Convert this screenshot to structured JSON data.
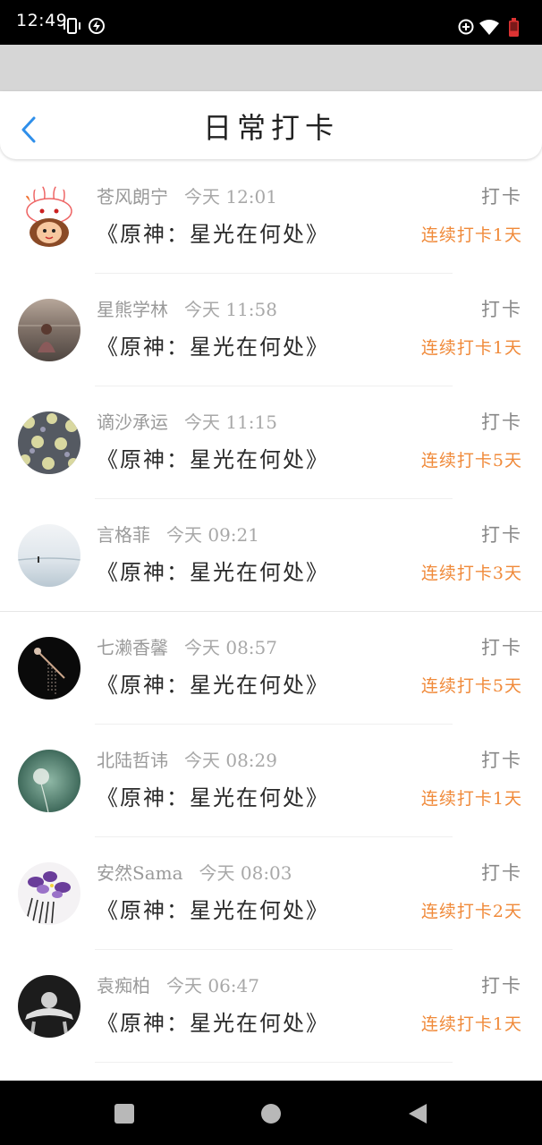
{
  "status_bar": {
    "time": "12:49",
    "left_icons": [
      "vibrate-icon",
      "charging-icon"
    ],
    "right_icons": [
      "data-saver-icon",
      "wifi-icon",
      "battery-low-icon"
    ]
  },
  "header": {
    "title": "日常打卡",
    "back_icon": "chevron-left-icon",
    "accent_color": "#2f8fea"
  },
  "records": [
    {
      "name": "苍风朗宁",
      "time": "今天 12:01",
      "book": "《原神：星光在何处》",
      "action": "打卡",
      "streak": "连续打卡1天",
      "avatar": "cartoon-bunny-girl"
    },
    {
      "name": "星熊学林",
      "time": "今天 11:58",
      "book": "《原神：星光在何处》",
      "action": "打卡",
      "streak": "连续打卡1天",
      "avatar": "sea-sunset-girl"
    },
    {
      "name": "谪沙承运",
      "time": "今天 11:15",
      "book": "《原神：星光在何处》",
      "action": "打卡",
      "streak": "连续打卡5天",
      "avatar": "floral-pattern"
    },
    {
      "name": "言格菲",
      "time": "今天 09:21",
      "book": "《原神：星光在何处》",
      "action": "打卡",
      "streak": "连续打卡3天",
      "avatar": "beach-figure"
    },
    {
      "name": "七濑香馨",
      "time": "今天 08:57",
      "book": "《原神：星光在何处》",
      "action": "打卡",
      "streak": "连续打卡5天",
      "avatar": "hairpin-dark"
    },
    {
      "name": "北陆哲讳",
      "time": "今天 08:29",
      "book": "《原神：星光在何处》",
      "action": "打卡",
      "streak": "连续打卡1天",
      "avatar": "dandelion"
    },
    {
      "name": "安然Sama",
      "time": "今天 08:03",
      "book": "《原神：星光在何处》",
      "action": "打卡",
      "streak": "连续打卡2天",
      "avatar": "purple-flowers-comb"
    },
    {
      "name": "袁痴柏",
      "time": "今天 06:47",
      "book": "《原神：星光在何处》",
      "action": "打卡",
      "streak": "连续打卡1天",
      "avatar": "bw-portrait"
    }
  ],
  "colors": {
    "streak": "#f08a3a",
    "name": "#9a9a9a",
    "checkin": "#888888"
  },
  "nav_bar": {
    "icons": [
      "recents-square-icon",
      "home-circle-icon",
      "back-triangle-icon"
    ]
  }
}
